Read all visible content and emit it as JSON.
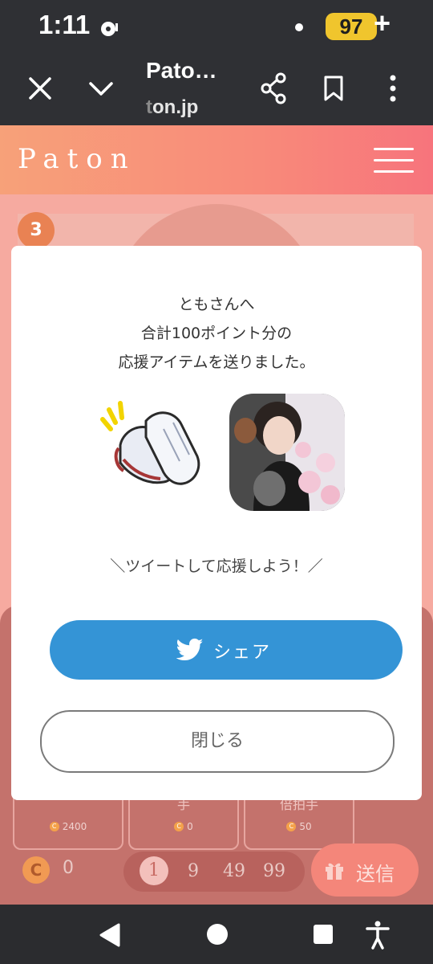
{
  "status_bar": {
    "time": "1:11",
    "battery": "97"
  },
  "browser": {
    "title": "Pato…",
    "url_fade": "t",
    "url_rest": "on.jp"
  },
  "site": {
    "logo": "Paton"
  },
  "content": {
    "rank": "3",
    "items": [
      {
        "label": "",
        "price": "2400"
      },
      {
        "label": "手",
        "price": "0"
      },
      {
        "label": "倍拍手",
        "price": "50"
      }
    ],
    "balance": "0",
    "quantities": [
      "1",
      "9",
      "49",
      "99"
    ],
    "selected_quantity": "1",
    "send_label": "送信"
  },
  "modal": {
    "line1": "ともさんへ",
    "line2": "合計100ポイント分の",
    "line3": "応援アイテムを送りました。",
    "tweet_prompt": "＼ツイートして応援しよう！／",
    "share_label": "シェア",
    "close_label": "閉じる"
  },
  "colors": {
    "share": "#3494d6",
    "header_start": "#f7a179",
    "header_end": "#f7747c",
    "battery": "#f0c52d"
  }
}
